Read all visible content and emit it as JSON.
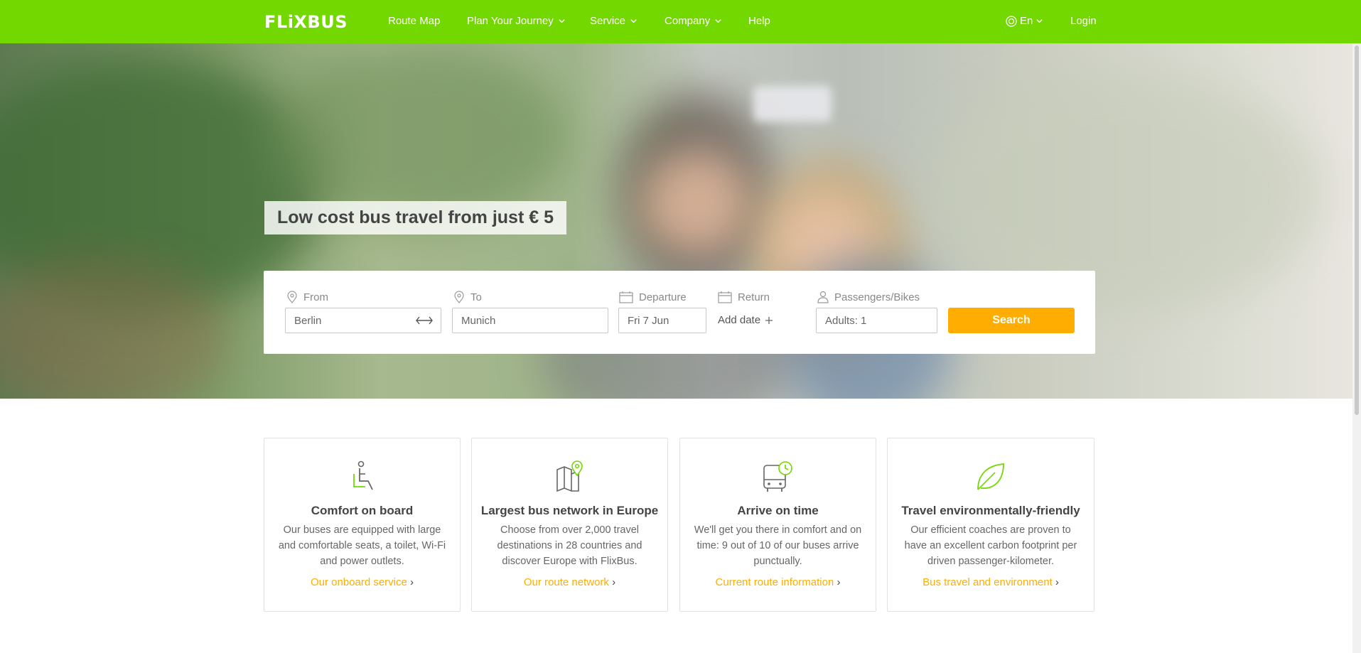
{
  "header": {
    "logo": "FLiXBUS",
    "nav": [
      {
        "label": "Route Map"
      },
      {
        "label": "Plan Your Journey"
      },
      {
        "label": "Service"
      },
      {
        "label": "Company"
      },
      {
        "label": "Help"
      }
    ],
    "language": "En",
    "login": "Login"
  },
  "hero": {
    "headline": "Low cost bus travel from just € 5"
  },
  "search": {
    "from_label": "From",
    "from_value": "Berlin",
    "to_label": "To",
    "to_value": "Munich",
    "departure_label": "Departure",
    "departure_value": "Fri 7 Jun",
    "return_label": "Return",
    "add_date": "Add date",
    "passengers_label": "Passengers/Bikes",
    "passengers_value": "Adults: 1",
    "search_button": "Search"
  },
  "features": [
    {
      "icon": "seat-icon",
      "title": "Comfort on board",
      "text": "Our buses are equipped with large and comfortable seats, a toilet, Wi-Fi and power outlets.",
      "link": "Our onboard service"
    },
    {
      "icon": "map-pin-icon",
      "title": "Largest bus network in Europe",
      "text": "Choose from over 2,000 travel destinations in 28 countries and discover Europe with FlixBus.",
      "link": "Our route network"
    },
    {
      "icon": "bus-clock-icon",
      "title": "Arrive on time",
      "text": "We'll get you there in comfort and on time: 9 out of 10 of our buses arrive punctually.",
      "link": "Current route information"
    },
    {
      "icon": "leaf-icon",
      "title": "Travel environmentally-friendly",
      "text": "Our efficient coaches are proven to have an excellent carbon footprint per driven passenger-kilometer.",
      "link": "Bus travel and environment"
    }
  ],
  "colors": {
    "brand_green": "#73d700",
    "accent_orange": "#ffad00"
  }
}
